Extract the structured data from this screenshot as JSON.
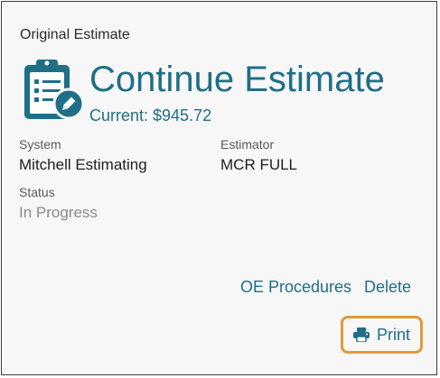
{
  "card": {
    "section_title": "Original Estimate",
    "hero": {
      "icon": "clipboard-edit-icon",
      "title": "Continue Estimate",
      "subtitle": "Current: $945.72"
    },
    "fields": {
      "system": {
        "label": "System",
        "value": "Mitchell Estimating"
      },
      "estimator": {
        "label": "Estimator",
        "value": "MCR FULL"
      },
      "status": {
        "label": "Status",
        "value": "In Progress"
      }
    },
    "actions": {
      "oe_procedures": "OE Procedures",
      "delete": "Delete",
      "print": "Print",
      "print_icon": "printer-icon"
    },
    "colors": {
      "accent": "#1f6f86",
      "highlight_border": "#e29a3a",
      "card_background": "#f7f7f7"
    }
  }
}
